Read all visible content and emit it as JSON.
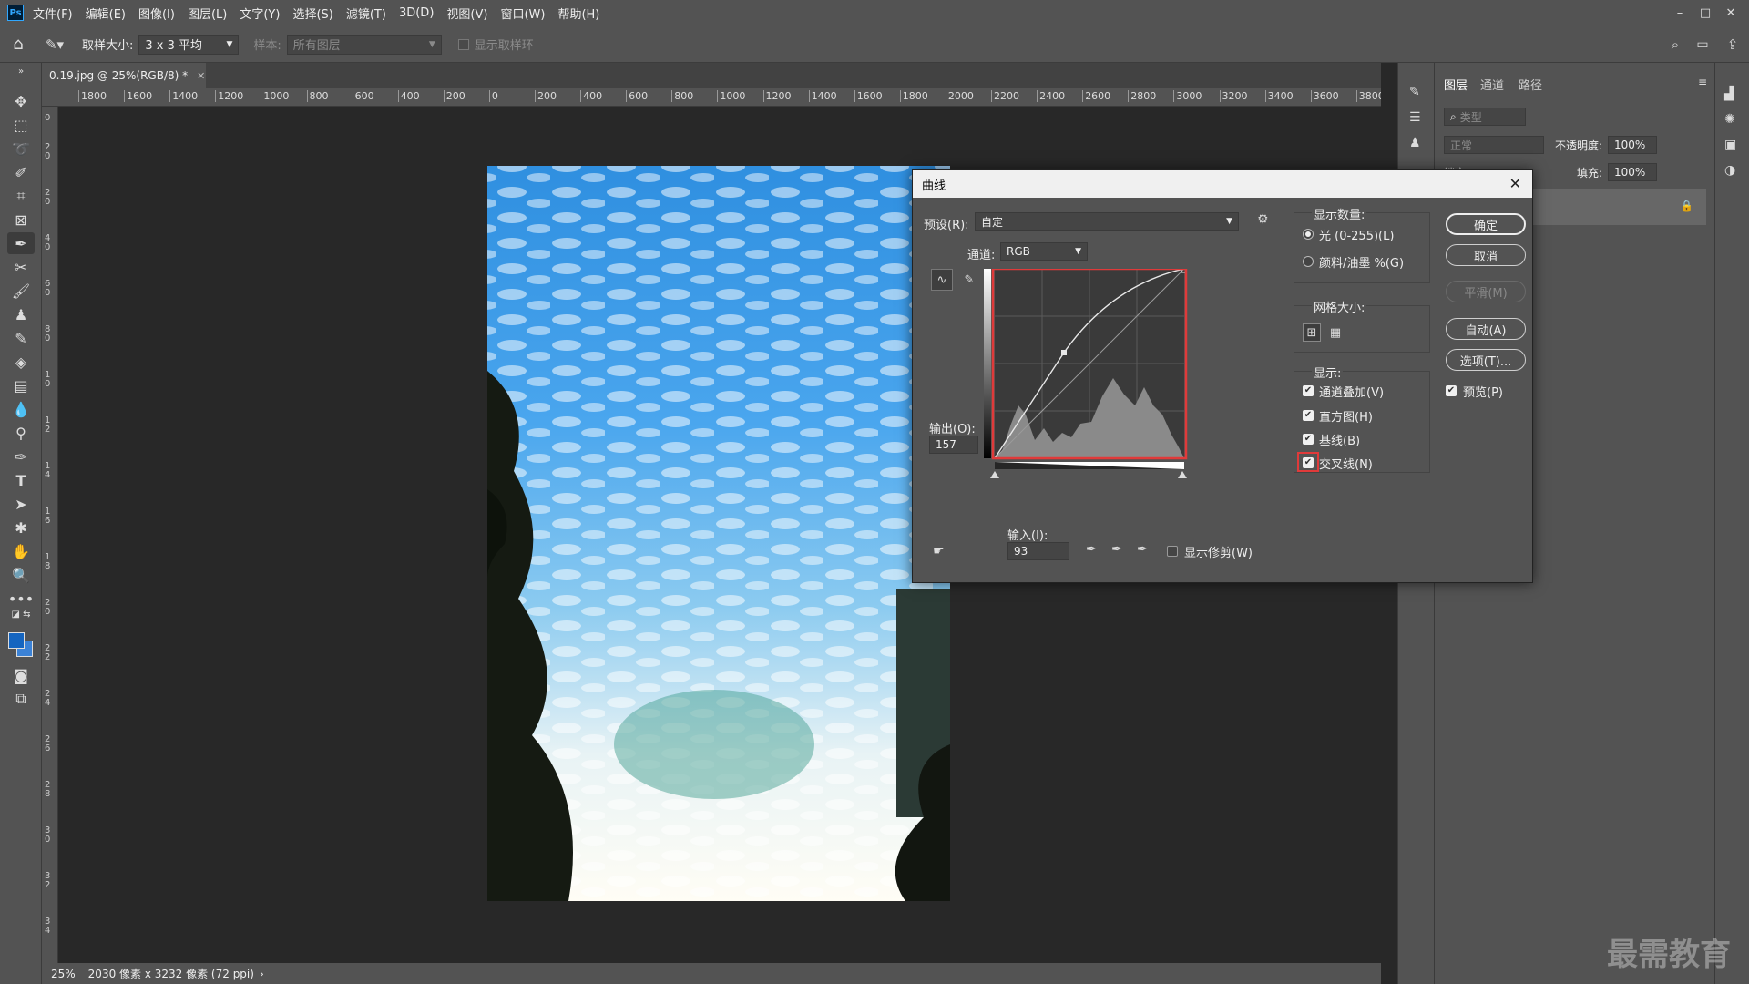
{
  "menubar": {
    "logo": "Ps",
    "items": [
      "文件(F)",
      "编辑(E)",
      "图像(I)",
      "图层(L)",
      "文字(Y)",
      "选择(S)",
      "滤镜(T)",
      "3D(D)",
      "视图(V)",
      "窗口(W)",
      "帮助(H)"
    ]
  },
  "options": {
    "sample_size_label": "取样大小:",
    "sample_size_value": "3 x 3 平均",
    "sample_label": "样本:",
    "sample_value": "所有图层",
    "show_ring_label": "显示取样环"
  },
  "document": {
    "tab_title": "0.19.jpg @ 25%(RGB/8) *",
    "ruler_ticks": [
      "1800",
      "1600",
      "1400",
      "1200",
      "1000",
      "800",
      "600",
      "400",
      "200",
      "0",
      "200",
      "400",
      "600",
      "800",
      "1000",
      "1200",
      "1400",
      "1600",
      "1800",
      "2000",
      "2200",
      "2400",
      "2600",
      "2800",
      "3000",
      "3200",
      "3400",
      "3600",
      "3800"
    ],
    "zoom": "25%",
    "info": "2030 像素 x 3232 像素 (72 ppi)"
  },
  "layers_panel": {
    "tabs": [
      "图层",
      "通道",
      "路径"
    ],
    "filter_placeholder": "类型",
    "blend_mode": "正常",
    "opacity_label": "不透明度:",
    "opacity_value": "100%",
    "lock_label": "锁定:",
    "fill_label": "填充:",
    "fill_value": "100%"
  },
  "dialog": {
    "title": "曲线",
    "preset_label": "预设(R):",
    "preset_value": "自定",
    "channel_label": "通道:",
    "channel_value": "RGB",
    "output_label": "输出(O):",
    "output_value": "157",
    "input_label": "输入(I):",
    "input_value": "93",
    "show_clipping_label": "显示修剪(W)",
    "show_amount_title": "显示数量:",
    "light_label": "光 (0-255)(L)",
    "pigment_label": "颜料/油墨 %(G)",
    "grid_size_title": "网格大小:",
    "show_title": "显示:",
    "channel_overlays_label": "通道叠加(V)",
    "histogram_label": "直方图(H)",
    "baseline_label": "基线(B)",
    "intersection_label": "交叉线(N)",
    "ok_label": "确定",
    "cancel_label": "取消",
    "smooth_label": "平滑(M)",
    "auto_label": "自动(A)",
    "options_label": "选项(T)...",
    "preview_label": "预览(P)",
    "highlight_color": "#e03a3a"
  },
  "watermark": "最需教育"
}
